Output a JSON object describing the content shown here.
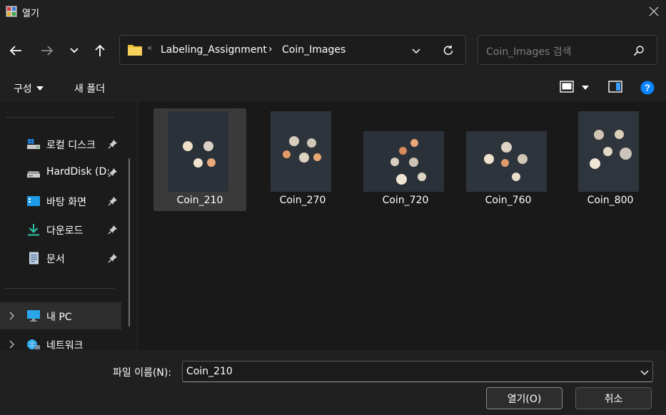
{
  "window": {
    "title": "열기"
  },
  "address": {
    "overflow": "«",
    "crumbs": [
      "Labeling_Assignment",
      "Coin_Images"
    ],
    "separator": "›"
  },
  "search": {
    "placeholder": "Coin_Images 검색"
  },
  "toolbar": {
    "organize_label": "구성",
    "new_folder_label": "새 폴더"
  },
  "sidebar": {
    "items": [
      {
        "label": "로컬 디스크",
        "icon": "local-disk-icon",
        "pinned": true
      },
      {
        "label": "HardDisk (D:)",
        "icon": "drive-icon",
        "pinned": true
      },
      {
        "label": "바탕 화면",
        "icon": "desktop-icon",
        "pinned": true
      },
      {
        "label": "다운로드",
        "icon": "download-icon",
        "pinned": true
      },
      {
        "label": "문서",
        "icon": "document-icon",
        "pinned": true
      }
    ],
    "tree": [
      {
        "label": "내 PC",
        "icon": "pc-icon",
        "selected": true
      },
      {
        "label": "네트워크",
        "icon": "network-icon",
        "selected": false
      }
    ]
  },
  "files": [
    {
      "name": "Coin_210",
      "selected": true
    },
    {
      "name": "Coin_270",
      "selected": false
    },
    {
      "name": "Coin_720",
      "selected": false
    },
    {
      "name": "Coin_760",
      "selected": false
    },
    {
      "name": "Coin_800",
      "selected": false
    }
  ],
  "bottom": {
    "filename_label": "파일 이름(N):",
    "filename_value": "Coin_210",
    "open_label": "열기(O)",
    "cancel_label": "취소"
  },
  "colors": {
    "accent": "#0a84ff",
    "folder": "#f0c33c",
    "background": "#202020"
  }
}
